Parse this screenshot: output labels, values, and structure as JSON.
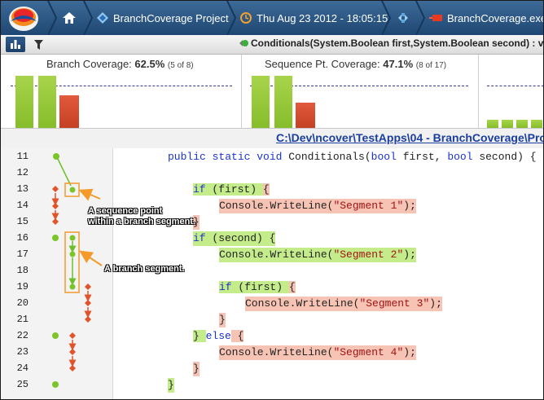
{
  "topbar": {
    "project": "BranchCoverage Project",
    "datetime": "Thu Aug 23 2012 - 18:05:15",
    "executable": "BranchCoverage.exe"
  },
  "toolbar": {
    "method_signature": "Conditionals(System.Boolean first,System.Boolean second) : v"
  },
  "stats": {
    "branch": {
      "label": "Branch Coverage:",
      "percent": "62.5%",
      "counts": "(5 of 8)"
    },
    "sequence": {
      "label": "Sequence Pt. Coverage:",
      "percent": "47.1%",
      "counts": "(8 of 17)"
    }
  },
  "file_path": "C:\\Dev\\ncover\\TestApps\\04 - BranchCoverage\\Pro",
  "line_numbers": [
    "11",
    "12",
    "13",
    "14",
    "15",
    "16",
    "17",
    "18",
    "19",
    "20",
    "21",
    "22",
    "23",
    "24",
    "25"
  ],
  "code": {
    "l11": {
      "p1": "public static void ",
      "p2": "Conditionals",
      "p3": "(",
      "kw1": "bool",
      "p4": " first, ",
      "kw2": "bool",
      "p5": " second) {"
    },
    "l13": {
      "kw": "if",
      "cond": " (first) ",
      "brace": "{"
    },
    "l14": {
      "call": "Console.WriteLine(",
      "str": "\"Segment 1\"",
      "end": ");"
    },
    "l15": {
      "brace": "}"
    },
    "l16": {
      "kw": "if",
      "cond": " (second) ",
      "brace": "{"
    },
    "l17": {
      "call": "Console.WriteLine(",
      "str": "\"Segment 2\"",
      "end": ");"
    },
    "l19": {
      "kw": "if",
      "cond": " (first) ",
      "brace": "{"
    },
    "l20": {
      "call": "Console.WriteLine(",
      "str": "\"Segment 3\"",
      "end": ");"
    },
    "l21": {
      "brace": "}"
    },
    "l22": {
      "brace1": "} ",
      "kw": "else",
      "brace2": " {"
    },
    "l23": {
      "call": "Console.WriteLine(",
      "str": "\"Segment 4\"",
      "end": ");"
    },
    "l24": {
      "brace": "}"
    },
    "l25": {
      "brace": "}"
    }
  },
  "callouts": {
    "sequence_point_1": "A sequence point",
    "sequence_point_2": "within a branch segment.",
    "branch_segment": "A branch segment."
  },
  "colors": {
    "covered": "#c4ec8b",
    "uncovered": "#f7c3b4",
    "bar_green": "#86bd2a",
    "bar_red": "#c54124",
    "nav_bg": "#1f4773",
    "link": "#1a3fa0"
  }
}
